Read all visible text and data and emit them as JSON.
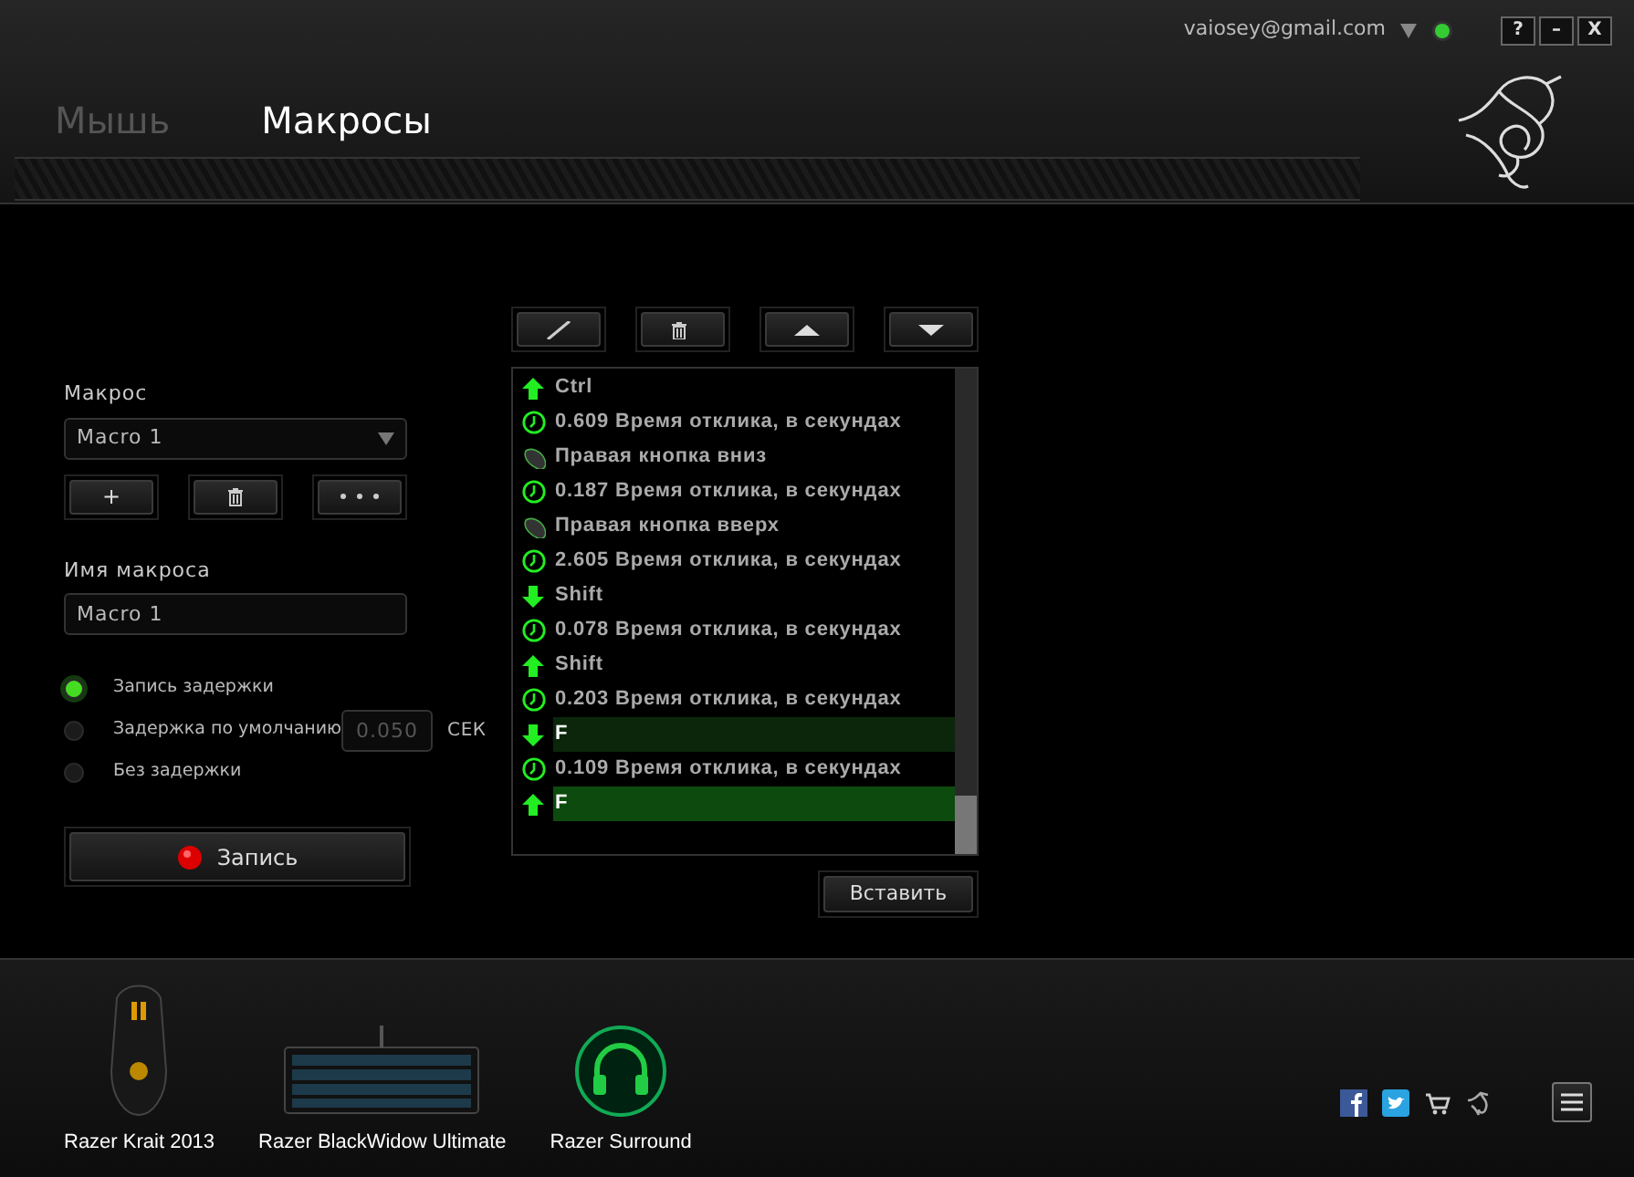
{
  "header": {
    "account": "vaiosey@gmail.com",
    "window_buttons": [
      "?",
      "–",
      "X"
    ]
  },
  "tabs": [
    {
      "label": "Мышь",
      "selected": false
    },
    {
      "label": "Макросы",
      "selected": true
    }
  ],
  "macro_panel": {
    "macro_label": "Макрос",
    "macro_select": "Macro 1",
    "macro_buttons": [
      {
        "kind": "add",
        "label": "+"
      },
      {
        "kind": "delete"
      },
      {
        "kind": "more"
      }
    ],
    "name_label": "Имя макроса",
    "name_value": "Macro 1",
    "delay_options": [
      {
        "label": "Запись задержки",
        "selected": true
      },
      {
        "label": "Задержка по умолчанию",
        "selected": false
      },
      {
        "label": "Без задержки",
        "selected": false
      }
    ],
    "default_delay": {
      "value": "0.050",
      "unit": "СЕК",
      "disabled": true
    },
    "record_button": "Запись"
  },
  "editor": {
    "toolbar": [
      {
        "kind": "edit"
      },
      {
        "kind": "delete"
      },
      {
        "kind": "up"
      },
      {
        "kind": "down"
      }
    ],
    "events": [
      {
        "kind": "key_up",
        "text": "Ctrl",
        "selected": false,
        "focused": false
      },
      {
        "kind": "delay",
        "text": "0.609 Время отклика, в секундах",
        "selected": false,
        "focused": false
      },
      {
        "kind": "mouse",
        "text": "Правая кнопка вниз",
        "selected": false,
        "focused": false
      },
      {
        "kind": "delay",
        "text": "0.187 Время отклика, в секундах",
        "selected": false,
        "focused": false
      },
      {
        "kind": "mouse",
        "text": "Правая кнопка вверх",
        "selected": false,
        "focused": false
      },
      {
        "kind": "delay",
        "text": "2.605 Время отклика, в секундах",
        "selected": false,
        "focused": false
      },
      {
        "kind": "key_down",
        "text": "Shift",
        "selected": false,
        "focused": false
      },
      {
        "kind": "delay",
        "text": "0.078 Время отклика, в секундах",
        "selected": false,
        "focused": false
      },
      {
        "kind": "key_up",
        "text": "Shift",
        "selected": false,
        "focused": false
      },
      {
        "kind": "delay",
        "text": "0.203 Время отклика, в секундах",
        "selected": false,
        "focused": false
      },
      {
        "kind": "key_down",
        "text": "F",
        "selected": true,
        "focused": false
      },
      {
        "kind": "delay",
        "text": "0.109 Время отклика, в секундах",
        "selected": false,
        "focused": false
      },
      {
        "kind": "key_up",
        "text": "F",
        "selected": true,
        "focused": true
      }
    ],
    "insert_button": "Вставить"
  },
  "footer": {
    "devices": [
      {
        "kind": "mouse",
        "label": "Razer Krait 2013"
      },
      {
        "kind": "keyboard",
        "label": "Razer BlackWidow Ultimate"
      },
      {
        "kind": "headset",
        "label": "Razer Surround"
      }
    ]
  }
}
